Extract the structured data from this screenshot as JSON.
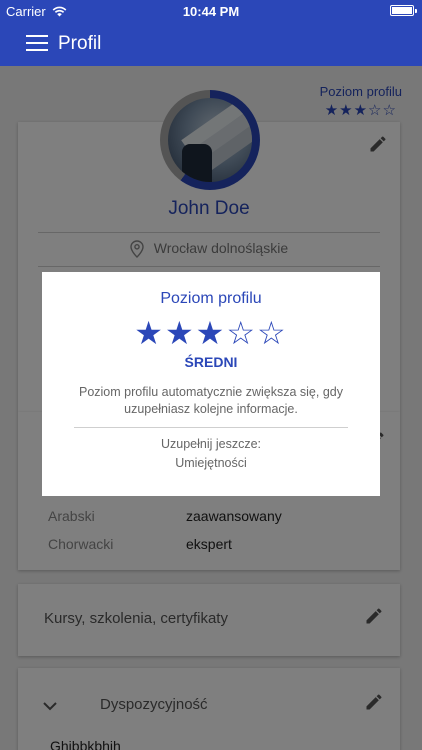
{
  "status_bar": {
    "carrier": "Carrier",
    "time": "10:44 PM"
  },
  "app_bar": {
    "title": "Profil",
    "menu_icon": "hamburger-icon"
  },
  "profile_level_widget": {
    "label": "Poziom profilu",
    "stars": "★★★☆☆",
    "filled": 3,
    "total": 5
  },
  "profile": {
    "name": "John Doe",
    "location": "Wrocław dolnośląskie",
    "avatar_progress": 0.6
  },
  "languages": [
    {
      "name": "Arabski",
      "level": "zaawansowany"
    },
    {
      "name": "Chorwacki",
      "level": "ekspert"
    }
  ],
  "courses": {
    "title": "Kursy, szkolenia, certyfikaty"
  },
  "availability": {
    "title": "Dyspozycyjność",
    "value": "Ghibbkbhih"
  },
  "modal": {
    "title": "Poziom profilu",
    "stars": "★★★☆☆",
    "filled": 3,
    "total": 5,
    "level": "ŚREDNI",
    "description": "Poziom profilu automatycznie zwiększa się, gdy uzupełniasz kolejne informacje.",
    "hint": "Uzupełnij jeszcze:",
    "missing": "Umiejętności"
  },
  "colors": {
    "primary": "#2b47b8",
    "overlay": "rgba(0,0,0,0.5)"
  }
}
